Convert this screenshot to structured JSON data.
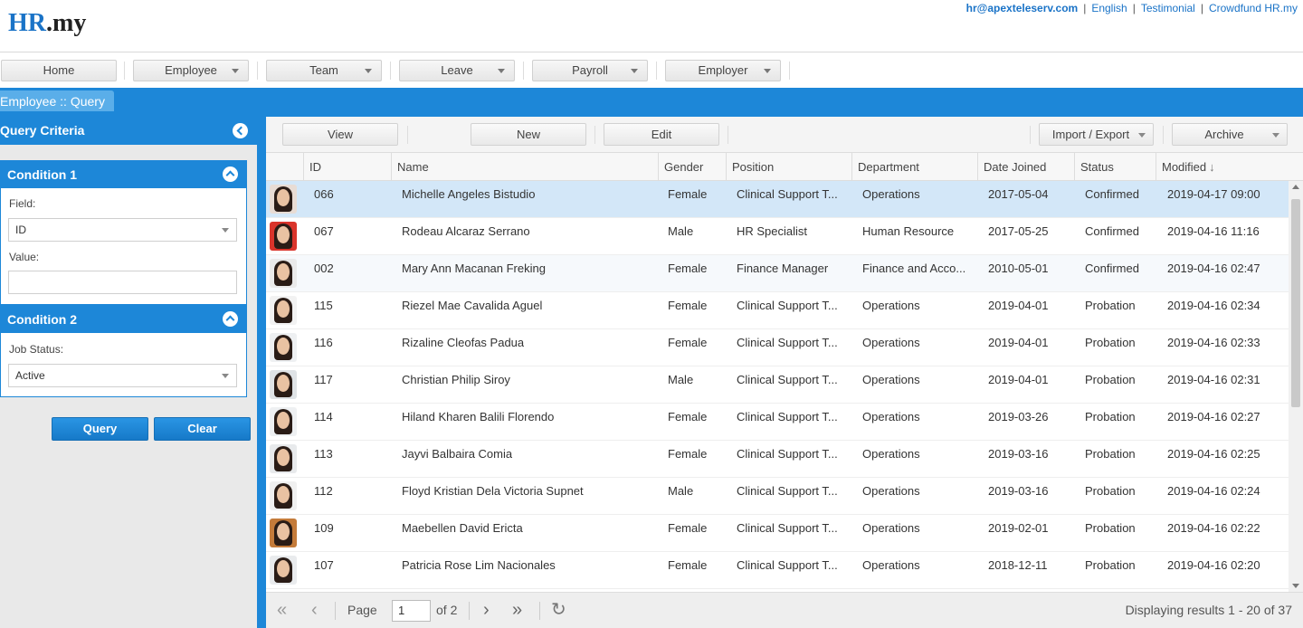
{
  "header": {
    "logo_hr": "HR",
    "logo_rest": ".my",
    "links": {
      "email": "hr@apexteleserv.com",
      "language": "English",
      "testimonial": "Testimonial",
      "crowdfund": "Crowdfund HR.my"
    },
    "separator": "|"
  },
  "menu": {
    "home": "Home",
    "employee": "Employee",
    "team": "Team",
    "leave": "Leave",
    "payroll": "Payroll",
    "employer": "Employer"
  },
  "page_title": "Employee :: Query",
  "query_panel": {
    "title": "Query Criteria",
    "condition1": {
      "title": "Condition 1",
      "field_label": "Field:",
      "field_value": "ID",
      "value_label": "Value:",
      "value": ""
    },
    "condition2": {
      "title": "Condition 2",
      "job_status_label": "Job Status:",
      "job_status_value": "Active"
    },
    "query_button": "Query",
    "clear_button": "Clear"
  },
  "toolbar": {
    "view": "View",
    "new": "New",
    "edit": "Edit",
    "import_export": "Import / Export",
    "archive": "Archive"
  },
  "columns": {
    "id": "ID",
    "name": "Name",
    "gender": "Gender",
    "position": "Position",
    "department": "Department",
    "date_joined": "Date Joined",
    "status": "Status",
    "modified": "Modified",
    "sort_arrow": "↓"
  },
  "rows": [
    {
      "id": "066",
      "name": "Michelle Angeles Bistudio",
      "gender": "Female",
      "position": "Clinical Support T...",
      "department": "Operations",
      "date_joined": "2017-05-04",
      "status": "Confirmed",
      "modified": "2019-04-17 09:00"
    },
    {
      "id": "067",
      "name": "Rodeau Alcaraz Serrano",
      "gender": "Male",
      "position": "HR Specialist",
      "department": "Human Resource",
      "date_joined": "2017-05-25",
      "status": "Confirmed",
      "modified": "2019-04-16 11:16"
    },
    {
      "id": "002",
      "name": "Mary Ann Macanan Freking",
      "gender": "Female",
      "position": "Finance Manager",
      "department": "Finance and Acco...",
      "date_joined": "2010-05-01",
      "status": "Confirmed",
      "modified": "2019-04-16 02:47"
    },
    {
      "id": "115",
      "name": "Riezel Mae Cavalida Aguel",
      "gender": "Female",
      "position": "Clinical Support T...",
      "department": "Operations",
      "date_joined": "2019-04-01",
      "status": "Probation",
      "modified": "2019-04-16 02:34"
    },
    {
      "id": "116",
      "name": "Rizaline Cleofas Padua",
      "gender": "Female",
      "position": "Clinical Support T...",
      "department": "Operations",
      "date_joined": "2019-04-01",
      "status": "Probation",
      "modified": "2019-04-16 02:33"
    },
    {
      "id": "117",
      "name": "Christian Philip Siroy",
      "gender": "Male",
      "position": "Clinical Support T...",
      "department": "Operations",
      "date_joined": "2019-04-01",
      "status": "Probation",
      "modified": "2019-04-16 02:31"
    },
    {
      "id": "114",
      "name": "Hiland Kharen Balili Florendo",
      "gender": "Female",
      "position": "Clinical Support T...",
      "department": "Operations",
      "date_joined": "2019-03-26",
      "status": "Probation",
      "modified": "2019-04-16 02:27"
    },
    {
      "id": "113",
      "name": "Jayvi Balbaira Comia",
      "gender": "Female",
      "position": "Clinical Support T...",
      "department": "Operations",
      "date_joined": "2019-03-16",
      "status": "Probation",
      "modified": "2019-04-16 02:25"
    },
    {
      "id": "112",
      "name": "Floyd Kristian Dela Victoria Supnet",
      "gender": "Male",
      "position": "Clinical Support T...",
      "department": "Operations",
      "date_joined": "2019-03-16",
      "status": "Probation",
      "modified": "2019-04-16 02:24"
    },
    {
      "id": "109",
      "name": "Maebellen David Ericta",
      "gender": "Female",
      "position": "Clinical Support T...",
      "department": "Operations",
      "date_joined": "2019-02-01",
      "status": "Probation",
      "modified": "2019-04-16 02:22"
    },
    {
      "id": "107",
      "name": "Patricia Rose Lim Nacionales",
      "gender": "Female",
      "position": "Clinical Support T...",
      "department": "Operations",
      "date_joined": "2018-12-11",
      "status": "Probation",
      "modified": "2019-04-16 02:20"
    }
  ],
  "pager": {
    "page_label": "Page",
    "page_value": "1",
    "of_label": "of 2",
    "display_text": "Displaying results 1 - 20 of 37",
    "first_icon": "double-chevron-left-icon",
    "prev_icon": "chevron-left-icon",
    "next_icon": "chevron-right-icon",
    "last_icon": "double-chevron-right-icon",
    "refresh_icon": "refresh-icon"
  },
  "colors": {
    "accent": "#1d87d8",
    "selected_row": "#d3e7f8",
    "link": "#1a73c7"
  }
}
